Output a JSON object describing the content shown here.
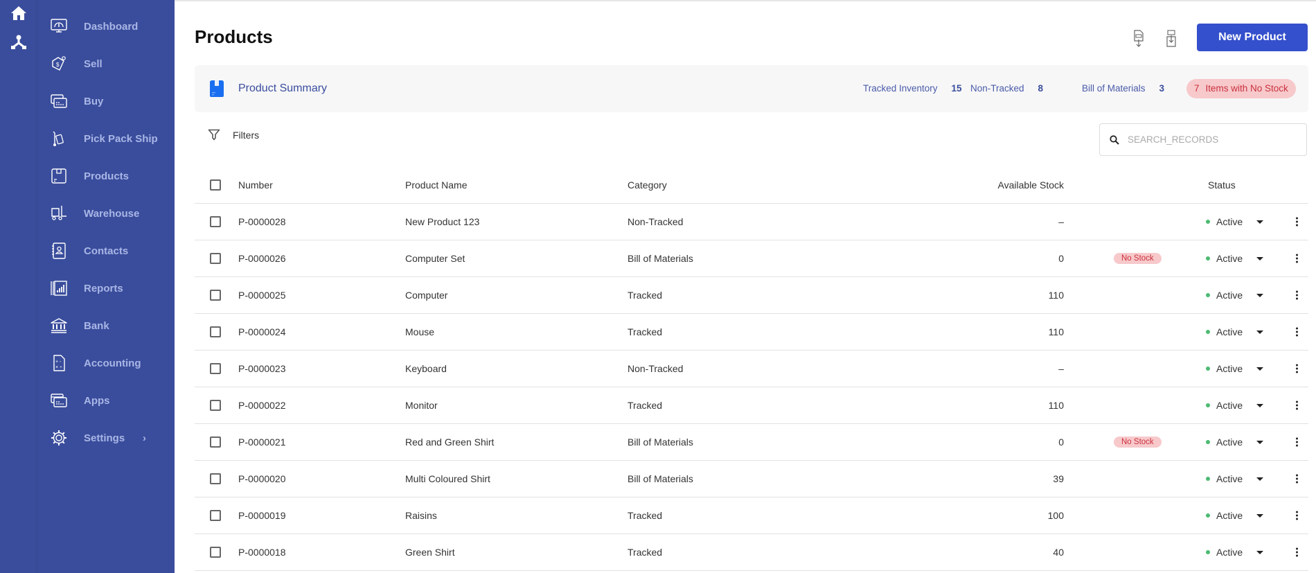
{
  "rail": {
    "items": [
      {
        "icon": "home-icon"
      },
      {
        "icon": "hierarchy-icon"
      }
    ]
  },
  "sidebar": {
    "items": [
      {
        "label": "Dashboard",
        "icon": "dashboard-icon"
      },
      {
        "label": "Sell",
        "icon": "price-tag-icon"
      },
      {
        "label": "Buy",
        "icon": "credit-card-icon"
      },
      {
        "label": "Pick Pack Ship",
        "icon": "hand-truck-icon"
      },
      {
        "label": "Products",
        "icon": "box-icon"
      },
      {
        "label": "Warehouse",
        "icon": "forklift-icon"
      },
      {
        "label": "Contacts",
        "icon": "contact-book-icon"
      },
      {
        "label": "Reports",
        "icon": "bar-chart-icon"
      },
      {
        "label": "Bank",
        "icon": "bank-icon"
      },
      {
        "label": "Accounting",
        "icon": "calculator-icon"
      },
      {
        "label": "Apps",
        "icon": "cards-icon"
      },
      {
        "label": "Settings",
        "icon": "gear-icon",
        "chevron": "›"
      }
    ]
  },
  "header": {
    "title": "Products",
    "export_icon": "file-export-icon",
    "import_icon": "file-import-icon",
    "new_button": "New Product"
  },
  "summary": {
    "title": "Product Summary",
    "stats": [
      {
        "label": "Tracked Inventory",
        "value": "15"
      },
      {
        "label": "Non-Tracked",
        "value": "8"
      },
      {
        "label": "Bill of Materials",
        "value": "3"
      }
    ],
    "no_stock": {
      "value": "7",
      "label": "Items with No Stock"
    }
  },
  "toolbar": {
    "filters_label": "Filters",
    "search_placeholder": "SEARCH_RECORDS",
    "search_value": ""
  },
  "table": {
    "columns": [
      "Number",
      "Product Name",
      "Category",
      "Available Stock",
      "Status"
    ],
    "rows": [
      {
        "number": "P-0000028",
        "name": "New Product 123",
        "category": "Non-Tracked",
        "stock": "–",
        "badge": "",
        "status": "Active"
      },
      {
        "number": "P-0000026",
        "name": "Computer Set",
        "category": "Bill of Materials",
        "stock": "0",
        "badge": "No Stock",
        "status": "Active"
      },
      {
        "number": "P-0000025",
        "name": "Computer",
        "category": "Tracked",
        "stock": "110",
        "badge": "",
        "status": "Active"
      },
      {
        "number": "P-0000024",
        "name": "Mouse",
        "category": "Tracked",
        "stock": "110",
        "badge": "",
        "status": "Active"
      },
      {
        "number": "P-0000023",
        "name": "Keyboard",
        "category": "Non-Tracked",
        "stock": "–",
        "badge": "",
        "status": "Active"
      },
      {
        "number": "P-0000022",
        "name": "Monitor",
        "category": "Tracked",
        "stock": "110",
        "badge": "",
        "status": "Active"
      },
      {
        "number": "P-0000021",
        "name": "Red and Green Shirt",
        "category": "Bill of Materials",
        "stock": "0",
        "badge": "No Stock",
        "status": "Active"
      },
      {
        "number": "P-0000020",
        "name": "Multi Coloured Shirt",
        "category": "Bill of Materials",
        "stock": "39",
        "badge": "",
        "status": "Active"
      },
      {
        "number": "P-0000019",
        "name": "Raisins",
        "category": "Tracked",
        "stock": "100",
        "badge": "",
        "status": "Active"
      },
      {
        "number": "P-0000018",
        "name": "Green Shirt",
        "category": "Tracked",
        "stock": "40",
        "badge": "",
        "status": "Active"
      }
    ]
  },
  "colors": {
    "sidebar": "#3a4d9c",
    "accent": "#3550cc",
    "active_dot": "#4cbb73",
    "no_stock_bg": "#f7c9cb",
    "no_stock_text": "#c9303d"
  }
}
